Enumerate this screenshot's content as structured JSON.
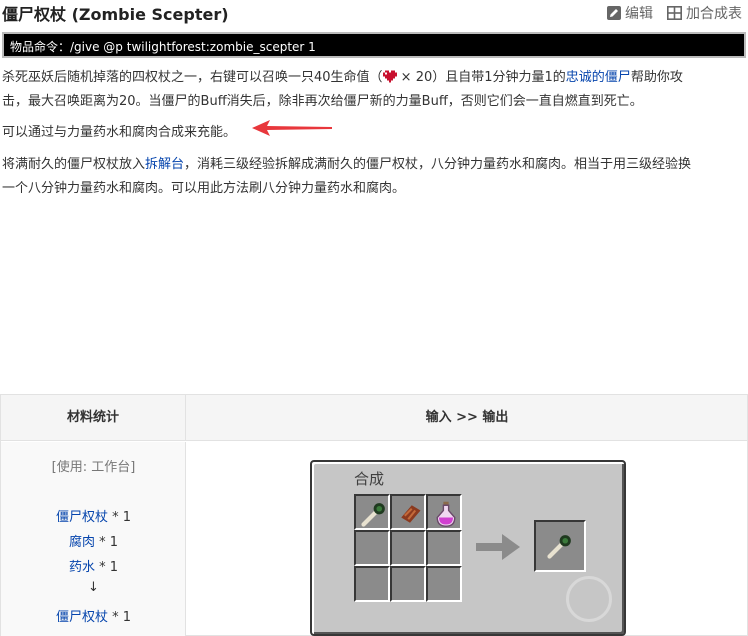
{
  "header": {
    "title": "僵尸权杖 (Zombie Scepter)",
    "edit_label": "编辑",
    "add_table_label": "加合成表"
  },
  "command": {
    "label": "物品命令：",
    "text": "/give @p twilightforest:zombie_scepter 1"
  },
  "description": {
    "p1_a": "杀死巫妖后随机掉落的四权杖之一，右键可以召唤一只40生命值（",
    "p1_b": " × 20）且自带1分钟力量1的",
    "p1_link": "忠诚的僵尸",
    "p1_c": "帮助你攻",
    "p1_line2": "击，最大召唤距离为20。当僵尸的Buff消失后，除非再次给僵尸新的力量Buff，否则它们会一直自燃直到死亡。",
    "p2": "可以通过与力量药水和腐肉合成来充能。",
    "p3_a": "将满耐久的僵尸权杖放入",
    "p3_link": "拆解台",
    "p3_b": "，消耗三级经验拆解成满耐久的僵尸权杖，八分钟力量药水和腐肉。相当于用三级经验换",
    "p3_line2": "一个八分钟力量药水和腐肉。可以用此方法刷八分钟力量药水和腐肉。"
  },
  "table": {
    "col_materials": "材料统计",
    "col_io": "输入 >> 输出",
    "usage": "[使用: 工作台]",
    "materials": [
      {
        "name": "僵尸权杖",
        "count": " * 1"
      },
      {
        "name": "腐肉",
        "count": " * 1"
      },
      {
        "name": "药水",
        "count": " * 1"
      }
    ],
    "result_arrow": "↓",
    "result": {
      "name": "僵尸权杖",
      "count": " * 1"
    }
  },
  "crafting": {
    "title": "合成",
    "grid": [
      [
        "zombie-scepter-icon",
        "rotten-flesh-icon",
        "potion-icon"
      ],
      [
        "",
        "",
        ""
      ],
      [
        "",
        "",
        ""
      ]
    ],
    "output": "zombie-scepter-icon"
  },
  "colors": {
    "link": "#0645ad",
    "annotation_arrow": "#e8373c"
  }
}
